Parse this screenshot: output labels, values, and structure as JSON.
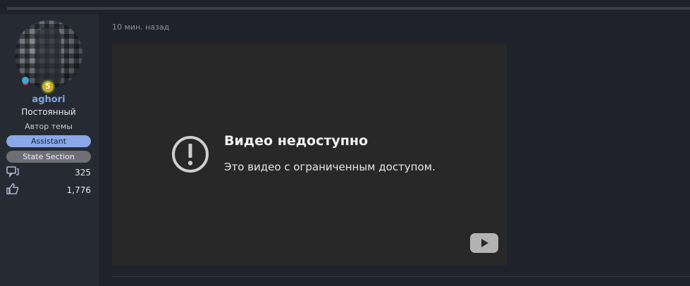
{
  "post": {
    "timestamp": "10 мин. назад"
  },
  "user": {
    "username": "aghori",
    "rank": "Постоянный",
    "role": "Автор темы",
    "level_badge": "5",
    "badges": [
      "Assistant",
      "State Section"
    ],
    "stats": {
      "messages_icon": "messages-icon",
      "messages": "325",
      "likes_icon": "thumbs-up-icon",
      "likes": "1,776"
    }
  },
  "video": {
    "title": "Видео недоступно",
    "message": "Это видео с ограниченным доступом.",
    "alert_icon": "exclamation-circle-icon",
    "play_icon": "youtube-play-icon"
  },
  "colors": {
    "page_bg": "#1f222a",
    "panel_bg": "#262a33",
    "username": "#7fa6e8",
    "assistant_pill": "#8aa8e8",
    "state_pill": "#6d6f75",
    "video_bg": "#282828"
  }
}
